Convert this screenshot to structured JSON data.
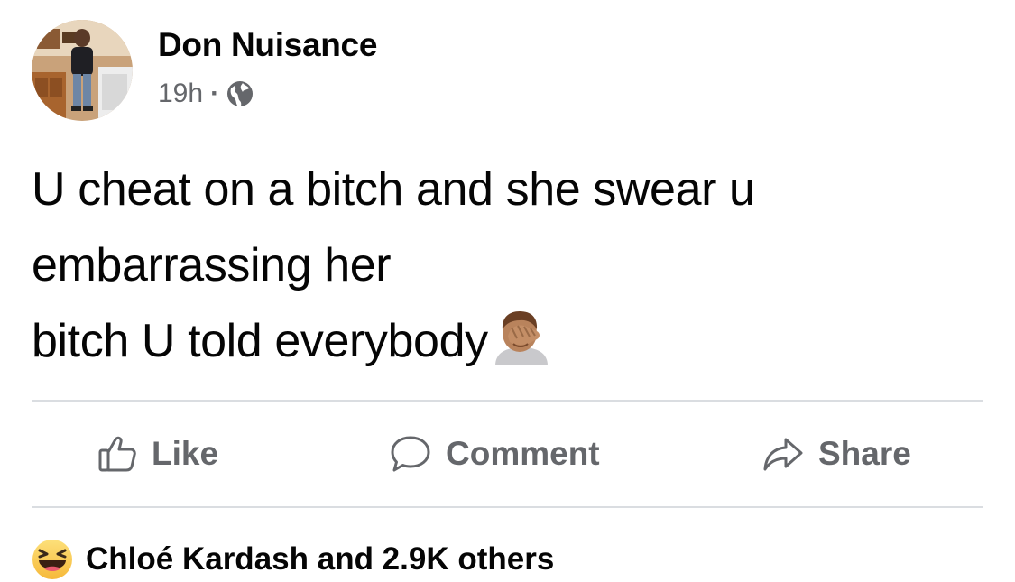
{
  "post": {
    "author_name": "Don Nuisance",
    "timestamp": "19h",
    "separator": "·",
    "privacy_icon": "globe-icon",
    "avatar_icon": "avatar-photo",
    "text_lines": [
      "U cheat on a bitch and she swear u",
      "embarrassing her",
      "bitch U told everybody"
    ],
    "trailing_emoji": "facepalm-emoji"
  },
  "actions": {
    "like_label": "Like",
    "comment_label": "Comment",
    "share_label": "Share"
  },
  "reactions": {
    "icon": "haha-reaction-icon",
    "summary": "Chloé Kardash and 2.9K others"
  },
  "colors": {
    "primary_text": "#050505",
    "secondary_text": "#65676b",
    "divider": "#dadde1"
  }
}
